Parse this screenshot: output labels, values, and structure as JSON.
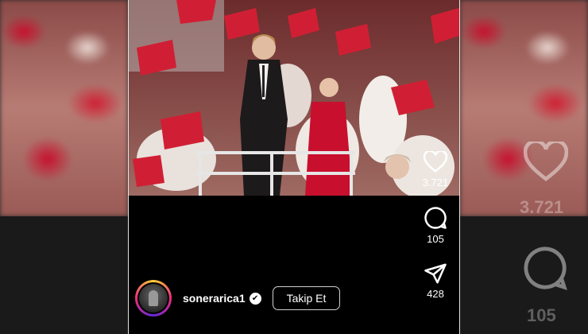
{
  "post": {
    "username": "sonerarica1",
    "verified": true,
    "follow_label": "Takip Et"
  },
  "actions": {
    "likes": "3.721",
    "comments": "105",
    "shares": "428"
  },
  "ghost": {
    "likes": "3.721",
    "comments": "105"
  },
  "icons": {
    "like": "heart-icon",
    "comment": "comment-icon",
    "share": "send-icon",
    "verified": "verified-badge-icon"
  },
  "colors": {
    "flag_red": "#c8102e",
    "background": "#000000",
    "text": "#ffffff"
  }
}
